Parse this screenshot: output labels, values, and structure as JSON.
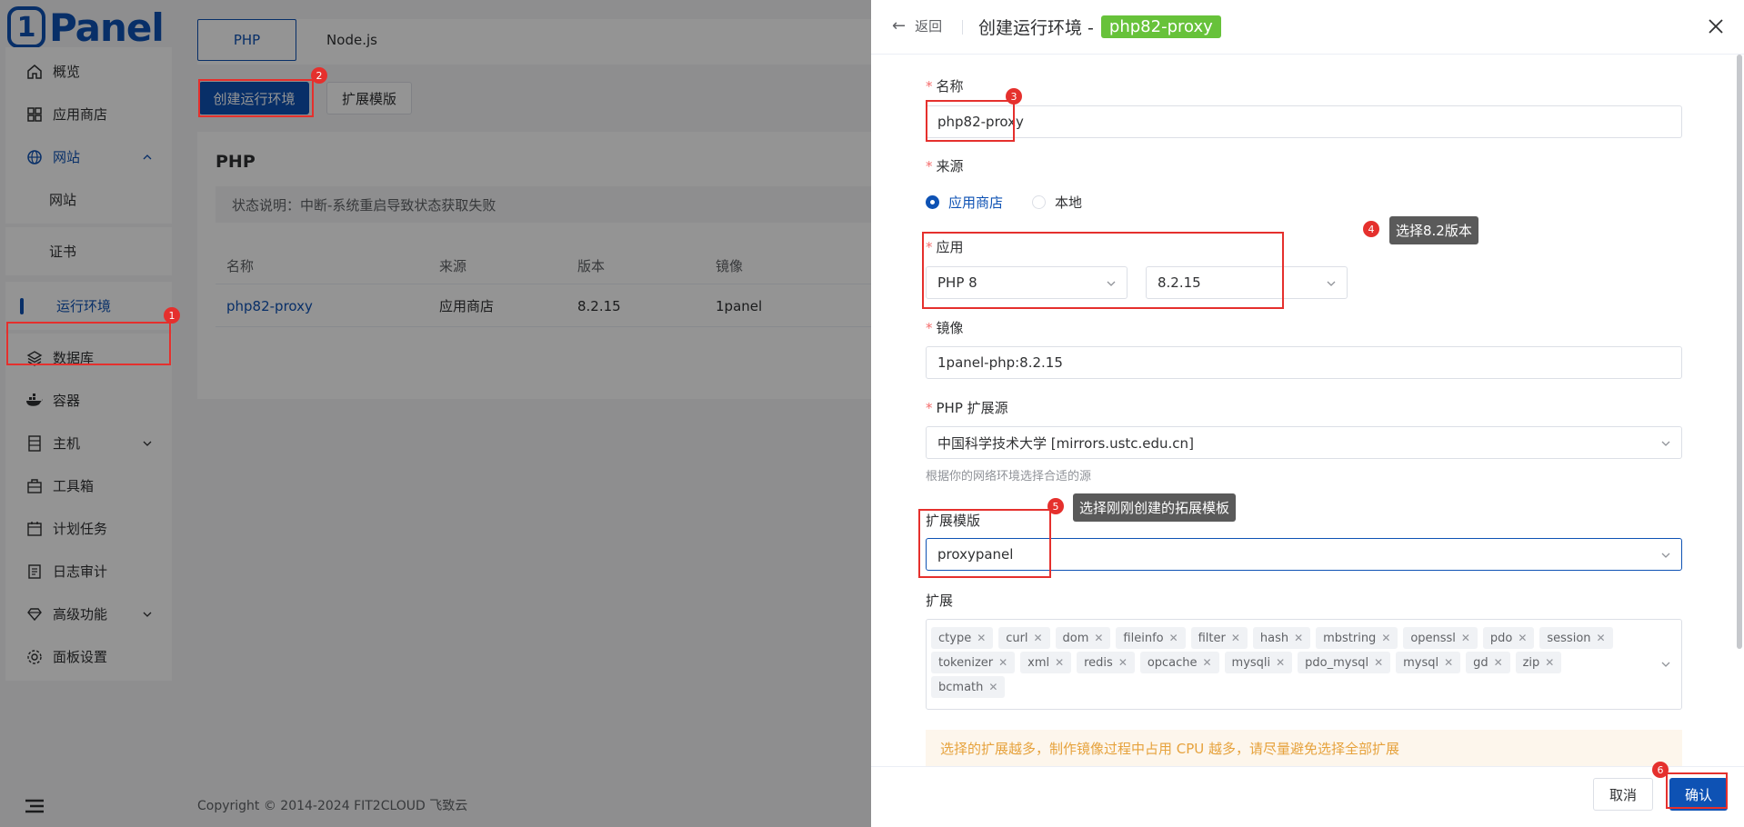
{
  "logo": {
    "badge": "1",
    "text": "Panel"
  },
  "sidebar": {
    "items": [
      {
        "label": "概览",
        "icon": "home-icon"
      },
      {
        "label": "应用商店",
        "icon": "grid-icon"
      },
      {
        "label": "网站",
        "icon": "globe-icon"
      },
      {
        "label": "网站"
      },
      {
        "label": "证书"
      },
      {
        "label": "运行环境"
      },
      {
        "label": "数据库",
        "icon": "layers-icon"
      },
      {
        "label": "容器",
        "icon": "docker-icon"
      },
      {
        "label": "主机",
        "icon": "server-icon"
      },
      {
        "label": "工具箱",
        "icon": "toolbox-icon"
      },
      {
        "label": "计划任务",
        "icon": "calendar-icon"
      },
      {
        "label": "日志审计",
        "icon": "log-icon"
      },
      {
        "label": "高级功能",
        "icon": "diamond-icon"
      },
      {
        "label": "面板设置",
        "icon": "gear-icon"
      }
    ]
  },
  "main": {
    "tabs": [
      "PHP",
      "Node.js"
    ],
    "create_button": "创建运行环境",
    "ext_button": "扩展模版",
    "card_title": "PHP",
    "status_note": "状态说明：中断-系统重启导致状态获取失败",
    "table": {
      "headers": [
        "名称",
        "来源",
        "版本",
        "镜像"
      ],
      "row": [
        "php82-proxy",
        "应用商店",
        "8.2.15",
        "1panel"
      ]
    },
    "copyright": "Copyright © 2014-2024 FIT2CLOUD 飞致云"
  },
  "drawer": {
    "back": "返回",
    "title": "创建运行环境 -",
    "title_tag": "php82-proxy",
    "name_label": "名称",
    "name_value": "php82-proxy",
    "source_label": "来源",
    "source_options": [
      "应用商店",
      "本地"
    ],
    "app_label": "应用",
    "app_value": "PHP 8",
    "version_value": "8.2.15",
    "image_label": "镜像",
    "image_value": "1panel-php:8.2.15",
    "ext_source_label": "PHP 扩展源",
    "ext_source_value": "中国科学技术大学 [mirrors.ustc.edu.cn]",
    "ext_source_hint": "根据你的网络环境选择合适的源",
    "template_label": "扩展模版",
    "template_value": "proxypanel",
    "ext_label": "扩展",
    "extensions": [
      [
        "ctype",
        "curl",
        "dom",
        "fileinfo",
        "filter",
        "hash",
        "mbstring",
        "openssl",
        "pdo",
        "session"
      ],
      [
        "tokenizer",
        "xml",
        "redis",
        "opcache",
        "mysqli",
        "pdo_mysql",
        "mysql",
        "gd",
        "zip"
      ],
      [
        "bcmath"
      ]
    ],
    "warning": "选择的扩展越多，制作镜像过程中占用 CPU 越多，请尽量避免选择全部扩展",
    "cancel": "取消",
    "confirm": "确认"
  },
  "annotations": {
    "markers": [
      "1",
      "2",
      "3",
      "4",
      "5",
      "6"
    ],
    "tip4": "选择8.2版本",
    "tip5": "选择刚刚创建的拓展模板"
  },
  "colors": {
    "primary": "#0e52b4",
    "annotation": "#e5302d",
    "tag_green": "#67c23a",
    "warning": "#e6a23c"
  }
}
